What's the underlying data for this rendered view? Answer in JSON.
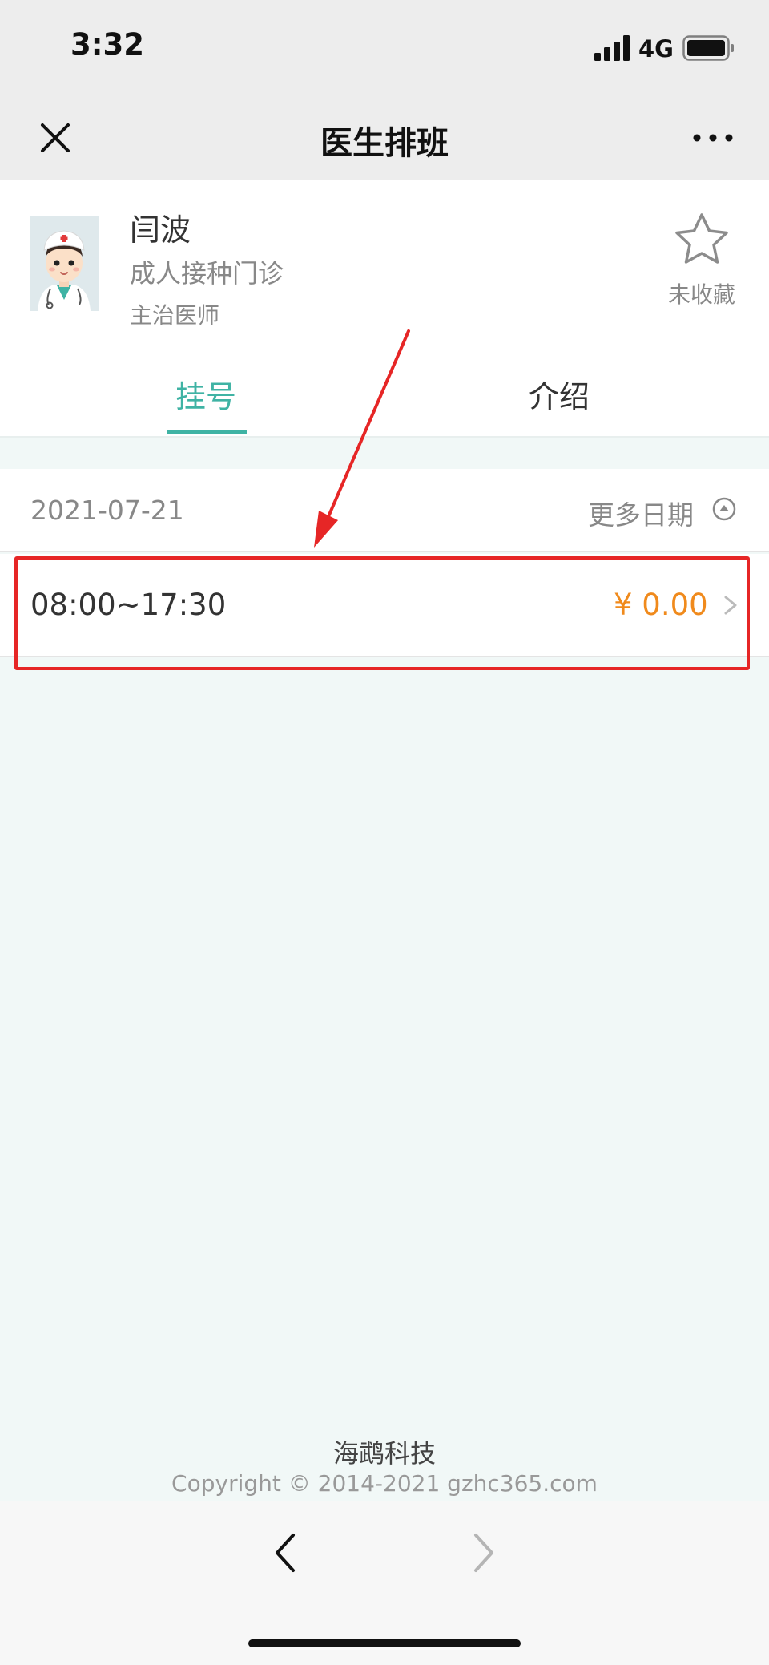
{
  "status_bar": {
    "time": "3:32",
    "network": "4G"
  },
  "nav": {
    "title": "医生排班",
    "close_icon": "close-icon",
    "more_icon": "more-dots-icon"
  },
  "doctor": {
    "name": "闫波",
    "department": "成人接种门诊",
    "title": "主治医师",
    "favorite_label": "未收藏",
    "avatar_icon": "doctor-avatar-icon"
  },
  "tabs": [
    {
      "label": "挂号",
      "active": true
    },
    {
      "label": "介绍",
      "active": false
    }
  ],
  "schedule": {
    "date": "2021-07-21",
    "more_dates_label": "更多日期",
    "slots": [
      {
        "time": "08:00~17:30",
        "price": "¥ 0.00"
      }
    ]
  },
  "footer": {
    "brand": "海鹉科技",
    "copyright": "Copyright © 2014-2021 gzhc365.com"
  },
  "colors": {
    "accent": "#3fb3a4",
    "price": "#f08a1c",
    "highlight": "#e62626"
  }
}
